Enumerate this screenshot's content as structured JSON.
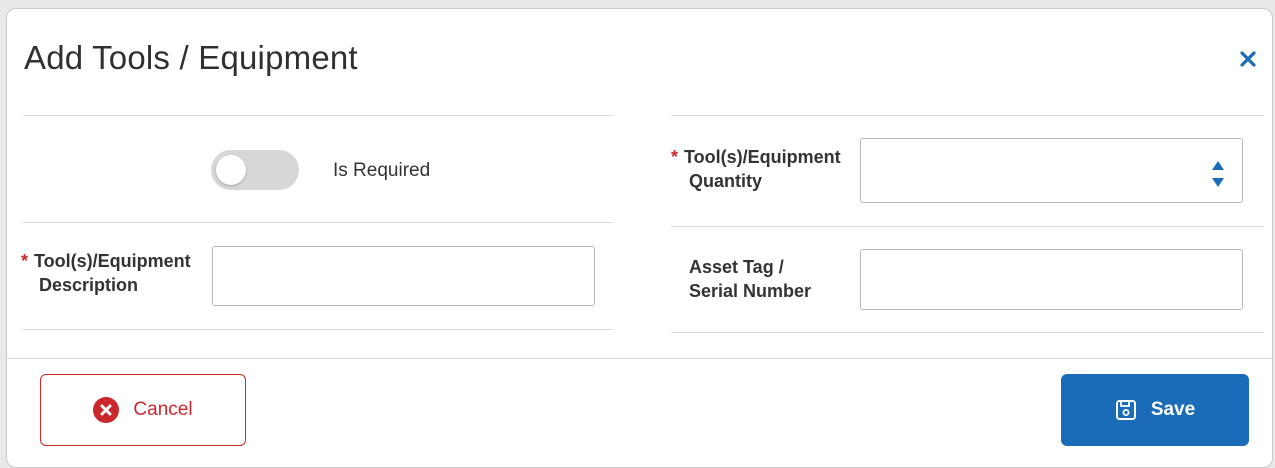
{
  "dialog": {
    "title": "Add Tools / Equipment",
    "close_icon": "close-icon"
  },
  "form": {
    "is_required": {
      "label": "Is Required",
      "checked": false
    },
    "quantity": {
      "required": true,
      "label_line1": "Tool(s)/Equipment",
      "label_line2": "Quantity",
      "value": ""
    },
    "description": {
      "required": true,
      "label_line1": "Tool(s)/Equipment",
      "label_line2": "Description",
      "value": ""
    },
    "asset_tag": {
      "required": false,
      "label_line1": "Asset Tag /",
      "label_line2": "Serial Number",
      "value": ""
    }
  },
  "footer": {
    "cancel_label": "Cancel",
    "cancel_icon": "times-circle-icon",
    "save_label": "Save",
    "save_icon": "floppy-disk-icon"
  },
  "colors": {
    "primary": "#1a6bb8",
    "danger": "#c9282d"
  }
}
